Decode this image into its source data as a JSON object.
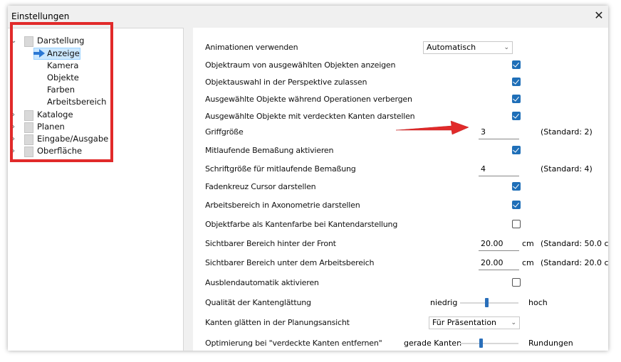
{
  "window": {
    "title": "Einstellungen",
    "close_glyph": "✕"
  },
  "tree": {
    "items": [
      {
        "label": "Darstellung",
        "expanded": true
      },
      {
        "label": "Anzeige",
        "selected": true
      },
      {
        "label": "Kamera"
      },
      {
        "label": "Objekte"
      },
      {
        "label": "Farben"
      },
      {
        "label": "Arbeitsbereich"
      },
      {
        "label": "Kataloge"
      },
      {
        "label": "Planen"
      },
      {
        "label": "Eingabe/Ausgabe"
      },
      {
        "label": "Oberfläche"
      }
    ],
    "chevron_right": "›",
    "chevron_down": "⌄"
  },
  "settings": {
    "animationen": {
      "label": "Animationen verwenden",
      "value": "Automatisch"
    },
    "objektraum": {
      "label": "Objektraum von ausgewählten Objekten anzeigen",
      "checked": true
    },
    "objektauswahl": {
      "label": "Objektauswahl in der Perspektive zulassen",
      "checked": true
    },
    "verbergen": {
      "label": "Ausgewählte Objekte während Operationen verbergen",
      "checked": true
    },
    "verdeckte": {
      "label": "Ausgewählte Objekte mit verdeckten Kanten darstellen",
      "checked": true
    },
    "griffgroesse": {
      "label": "Griffgröße",
      "value": "3",
      "standard": "(Standard: 2)"
    },
    "mitlaufend": {
      "label": "Mitlaufende Bemaßung aktivieren",
      "checked": true
    },
    "schriftgroesse": {
      "label": "Schriftgröße für mitlaufende Bemaßung",
      "value": "4",
      "standard": "(Standard: 4)"
    },
    "fadenkreuz": {
      "label": "Fadenkreuz Cursor darstellen",
      "checked": true
    },
    "axonometrie": {
      "label": "Arbeitsbereich in Axonometrie darstellen",
      "checked": true
    },
    "objektfarbe": {
      "label": "Objektfarbe als Kantenfarbe bei Kantendarstellung",
      "checked": false
    },
    "front": {
      "label": "Sichtbarer Bereich hinter der Front",
      "value": "20.00",
      "unit": "cm",
      "standard": "(Standard: 50.0 cm)"
    },
    "arbeitsbereich": {
      "label": "Sichtbarer Bereich unter dem Arbeitsbereich",
      "value": "20.00",
      "unit": "cm",
      "standard": "(Standard: 20.0 cm)"
    },
    "ausblend": {
      "label": "Ausblendautomatik aktivieren",
      "checked": false
    },
    "kantenglaettung": {
      "label": "Qualität der Kantenglättung",
      "low": "niedrig",
      "high": "hoch",
      "level": 0.45
    },
    "planungsansicht": {
      "label": "Kanten glätten in der Planungsansicht",
      "value": "Für Präsentation"
    },
    "optimierung": {
      "label": "Optimierung bei \"verdeckte Kanten entfernen\"",
      "low": "gerade Kanten",
      "high": "Rundungen",
      "level": 0.35
    }
  },
  "colors": {
    "accent": "#1f6fb8",
    "annotation_red": "#e12a2a",
    "selection": "#cce8ff"
  }
}
